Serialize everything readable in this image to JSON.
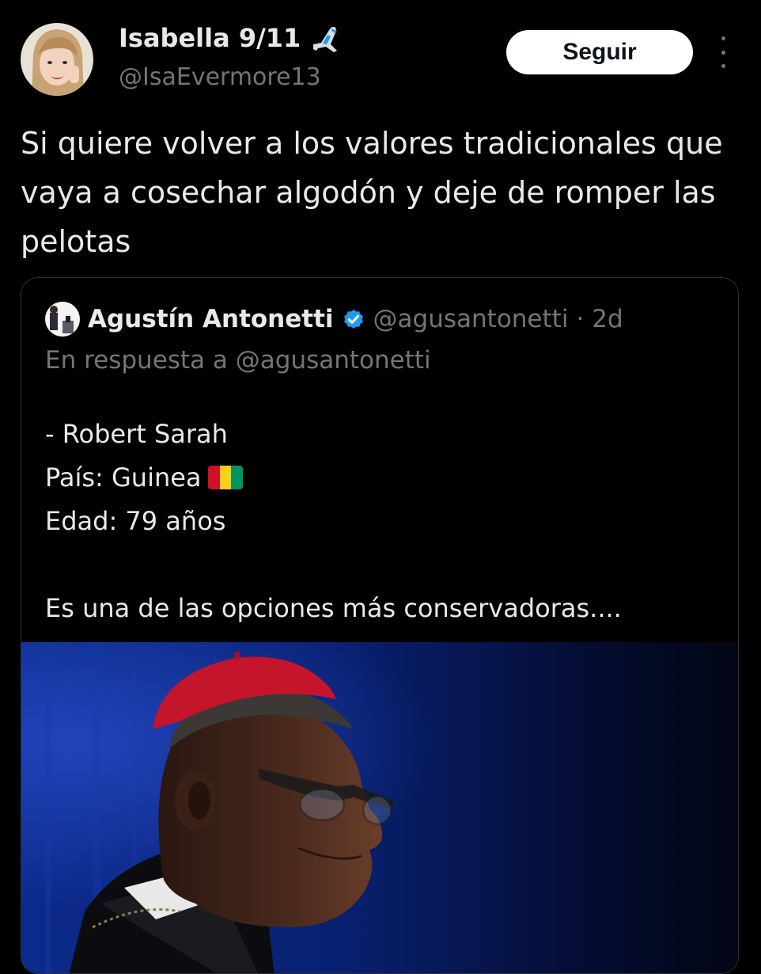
{
  "tweet": {
    "author_name": "Isabella 9/11",
    "author_handle": "@IsaEvermore13",
    "follow_label": "Seguir",
    "text": "Si quiere volver a los valores tradicionales que vaya a cosechar algodón y deje de romper las pelotas"
  },
  "quoted": {
    "author_name": "Agustín Antonetti",
    "author_handle": "@agusantonetti",
    "separator": "·",
    "timestamp": "2d",
    "reply_to": "En respuesta a @agusantonetti",
    "lines": [
      "- Robert Sarah",
      "País: Guinea",
      "Edad: 79 años",
      "",
      "Es una de las opciones más conservadoras...."
    ]
  },
  "colors": {
    "background": "#000000",
    "text_primary": "#e7e9ea",
    "text_secondary": "#71767b",
    "verified_blue": "#1d9bf0",
    "border": "#2f3336"
  },
  "icons": [
    "airplane-emoji",
    "verified-badge-icon",
    "more-options-icon",
    "guinea-flag-emoji"
  ]
}
